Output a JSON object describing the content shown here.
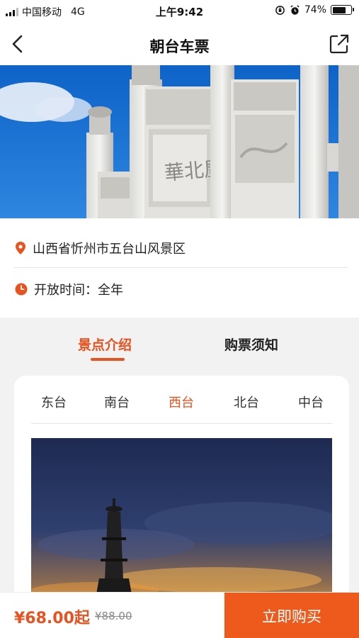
{
  "status_bar": {
    "carrier": "中国移动",
    "network": "4G",
    "time": "上午9:42",
    "battery": "74%",
    "battery_level": 0.74
  },
  "nav": {
    "title": "朝台车票",
    "back_icon": "chevron-left-icon",
    "share_icon": "share-external-icon"
  },
  "hero": {
    "description_icon": "stone-archway-image"
  },
  "info": {
    "address": "山西省忻州市五台山风景区",
    "hours": "开放时间：全年",
    "colors": {
      "accent": "#e8521e"
    }
  },
  "tabs": [
    {
      "label": "景点介绍",
      "active": true
    },
    {
      "label": "购票须知",
      "active": false
    }
  ],
  "subtabs": [
    {
      "label": "东台",
      "active": false
    },
    {
      "label": "南台",
      "active": false
    },
    {
      "label": "西台",
      "active": true
    },
    {
      "label": "北台",
      "active": false
    },
    {
      "label": "中台",
      "active": false
    }
  ],
  "card": {
    "image_icon": "pagoda-sunset-image"
  },
  "bottom": {
    "price": "¥68.00起",
    "original_price": "¥88.00",
    "buy_label": "立即购买",
    "buy_color": "#ed5a1c"
  }
}
